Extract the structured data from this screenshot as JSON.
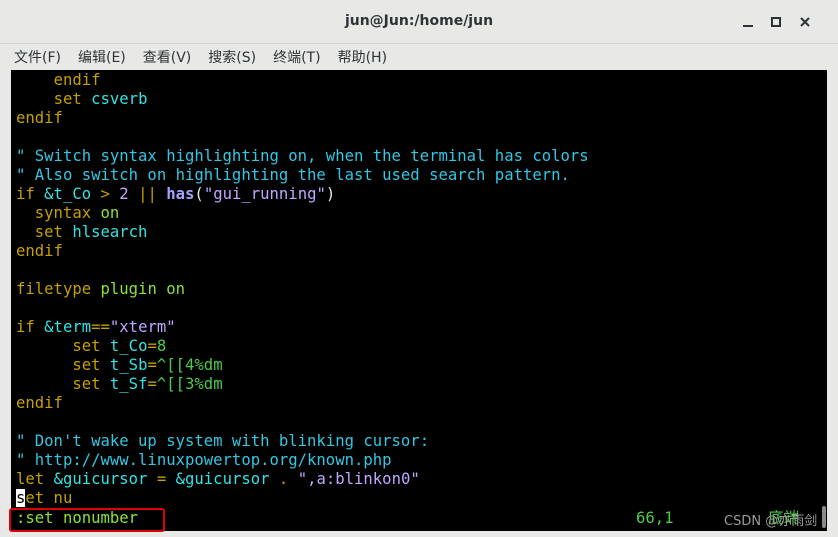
{
  "window": {
    "title": "jun@Jun:/home/jun",
    "minimize_glyph": "▁",
    "maximize_glyph": "▫",
    "close_glyph": "✕"
  },
  "menubar": {
    "items": [
      "文件(F)",
      "编辑(E)",
      "查看(V)",
      "搜索(S)",
      "终端(T)",
      "帮助(H)"
    ]
  },
  "terminal": {
    "lines": [
      [
        {
          "t": "    ",
          "c": "w"
        },
        {
          "t": "endif",
          "c": "y"
        }
      ],
      [
        {
          "t": "    ",
          "c": "w"
        },
        {
          "t": "set ",
          "c": "y"
        },
        {
          "t": "csverb",
          "c": "c"
        }
      ],
      [
        {
          "t": "endif",
          "c": "y"
        }
      ],
      [
        {
          "t": "",
          "c": "w"
        }
      ],
      [
        {
          "t": "\" Switch syntax highlighting on, when the terminal has colors",
          "c": "cm"
        }
      ],
      [
        {
          "t": "\" Also switch on highlighting the last used search pattern.",
          "c": "cm"
        }
      ],
      [
        {
          "t": "if ",
          "c": "y"
        },
        {
          "t": "&t_Co",
          "c": "c"
        },
        {
          "t": " > ",
          "c": "y"
        },
        {
          "t": "2",
          "c": "m"
        },
        {
          "t": " || ",
          "c": "y"
        },
        {
          "t": "has",
          "c": "bold"
        },
        {
          "t": "(",
          "c": "w"
        },
        {
          "t": "\"gui_running\"",
          "c": "m"
        },
        {
          "t": ")",
          "c": "w"
        }
      ],
      [
        {
          "t": "  ",
          "c": "w"
        },
        {
          "t": "syntax ",
          "c": "y"
        },
        {
          "t": "on",
          "c": "k"
        }
      ],
      [
        {
          "t": "  ",
          "c": "w"
        },
        {
          "t": "set ",
          "c": "y"
        },
        {
          "t": "hlsearch",
          "c": "c"
        }
      ],
      [
        {
          "t": "endif",
          "c": "y"
        }
      ],
      [
        {
          "t": "",
          "c": "w"
        }
      ],
      [
        {
          "t": "filetype ",
          "c": "y"
        },
        {
          "t": "plugin ",
          "c": "k"
        },
        {
          "t": "on",
          "c": "k"
        }
      ],
      [
        {
          "t": "",
          "c": "w"
        }
      ],
      [
        {
          "t": "if ",
          "c": "y"
        },
        {
          "t": "&term",
          "c": "c"
        },
        {
          "t": "==",
          "c": "y"
        },
        {
          "t": "\"xterm\"",
          "c": "m"
        }
      ],
      [
        {
          "t": "      ",
          "c": "w"
        },
        {
          "t": "set ",
          "c": "y"
        },
        {
          "t": "t_Co",
          "c": "c"
        },
        {
          "t": "=",
          "c": "y"
        },
        {
          "t": "8",
          "c": "g"
        }
      ],
      [
        {
          "t": "      ",
          "c": "w"
        },
        {
          "t": "set ",
          "c": "y"
        },
        {
          "t": "t_Sb",
          "c": "c"
        },
        {
          "t": "=",
          "c": "y"
        },
        {
          "t": "^[[4%dm",
          "c": "g"
        }
      ],
      [
        {
          "t": "      ",
          "c": "w"
        },
        {
          "t": "set ",
          "c": "y"
        },
        {
          "t": "t_Sf",
          "c": "c"
        },
        {
          "t": "=",
          "c": "y"
        },
        {
          "t": "^[[3%dm",
          "c": "g"
        }
      ],
      [
        {
          "t": "endif",
          "c": "y"
        }
      ],
      [
        {
          "t": "",
          "c": "w"
        }
      ],
      [
        {
          "t": "\" Don't wake up system with blinking cursor:",
          "c": "cm"
        }
      ],
      [
        {
          "t": "\" http://www.linuxpowertop.org/known.php",
          "c": "cm"
        }
      ],
      [
        {
          "t": "let ",
          "c": "y"
        },
        {
          "t": "&guicursor",
          "c": "c"
        },
        {
          "t": " = ",
          "c": "y"
        },
        {
          "t": "&guicursor",
          "c": "c"
        },
        {
          "t": " . ",
          "c": "y"
        },
        {
          "t": "\",a:blinkon0\"",
          "c": "m"
        }
      ],
      [
        {
          "t": "s",
          "c": "cursor"
        },
        {
          "t": "et nu",
          "c": "y"
        }
      ]
    ],
    "command_line": ":set nonumber",
    "ruler": "66,1",
    "position_label": "底端"
  },
  "watermark": "CSDN @亦雨剑"
}
